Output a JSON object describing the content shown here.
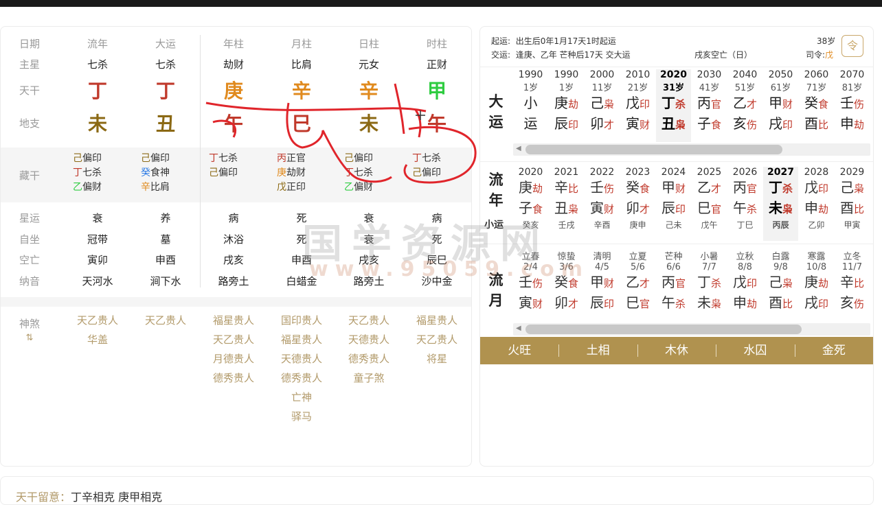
{
  "columns": [
    "日期",
    "流年",
    "大运",
    "年柱",
    "月柱",
    "日柱",
    "时柱"
  ],
  "zhuxing": [
    "主星",
    "七杀",
    "七杀",
    "劫财",
    "比肩",
    "元女",
    "正财"
  ],
  "tiangan": {
    "label": "天干",
    "chars": [
      "丁",
      "丁",
      "庚",
      "辛",
      "辛",
      "甲"
    ],
    "colors": [
      "#c0392b",
      "#c0392b",
      "#e08a1e",
      "#e08a1e",
      "#e08a1e",
      "#2ecc40"
    ]
  },
  "dizhi": {
    "label": "地支",
    "chars": [
      "未",
      "丑",
      "午",
      "巳",
      "未",
      "午"
    ],
    "colors": [
      "#8b6914",
      "#8b6914",
      "#c0392b",
      "#c0392b",
      "#8b6914",
      "#c0392b"
    ]
  },
  "canggan": {
    "label": "藏干",
    "cols": [
      [
        {
          "t": "己",
          "c": "#8b6914",
          "s": "偏印"
        },
        {
          "t": "丁",
          "c": "#c0392b",
          "s": "七杀"
        },
        {
          "t": "乙",
          "c": "#2ecc40",
          "s": "偏财"
        }
      ],
      [
        {
          "t": "己",
          "c": "#8b6914",
          "s": "偏印"
        },
        {
          "t": "癸",
          "c": "#2c7be5",
          "s": "食神"
        },
        {
          "t": "辛",
          "c": "#e08a1e",
          "s": "比肩"
        }
      ],
      [
        {
          "t": "丁",
          "c": "#c0392b",
          "s": "七杀"
        },
        {
          "t": "己",
          "c": "#8b6914",
          "s": "偏印"
        }
      ],
      [
        {
          "t": "丙",
          "c": "#c0392b",
          "s": "正官"
        },
        {
          "t": "庚",
          "c": "#e08a1e",
          "s": "劫财"
        },
        {
          "t": "戊",
          "c": "#8b6914",
          "s": "正印"
        }
      ],
      [
        {
          "t": "己",
          "c": "#8b6914",
          "s": "偏印"
        },
        {
          "t": "丁",
          "c": "#c0392b",
          "s": "七杀"
        },
        {
          "t": "乙",
          "c": "#2ecc40",
          "s": "偏财"
        }
      ],
      [
        {
          "t": "丁",
          "c": "#c0392b",
          "s": "七杀"
        },
        {
          "t": "己",
          "c": "#8b6914",
          "s": "偏印"
        }
      ]
    ]
  },
  "xingyun": [
    "星运",
    "衰",
    "养",
    "病",
    "死",
    "衰",
    "病"
  ],
  "zizuo": [
    "自坐",
    "冠带",
    "墓",
    "沐浴",
    "死",
    "衰",
    "死"
  ],
  "kongwang": [
    "空亡",
    "寅卯",
    "申酉",
    "戌亥",
    "申酉",
    "戌亥",
    "辰巳"
  ],
  "nayin": [
    "纳音",
    "天河水",
    "涧下水",
    "路旁土",
    "白蜡金",
    "路旁土",
    "沙中金"
  ],
  "shensha": {
    "label": "神煞",
    "cols": [
      [
        "天乙贵人",
        "华盖"
      ],
      [
        "天乙贵人"
      ],
      [
        "福星贵人",
        "天乙贵人",
        "月德贵人",
        "德秀贵人"
      ],
      [
        "国印贵人",
        "福星贵人",
        "天德贵人",
        "德秀贵人",
        "亡神",
        "驿马"
      ],
      [
        "天乙贵人",
        "天德贵人",
        "德秀贵人",
        "童子煞"
      ],
      [
        "福星贵人",
        "天乙贵人",
        "将星"
      ]
    ]
  },
  "header": {
    "qiyun_label": "起运:",
    "qiyun": "出生后0年1月17天1时起运",
    "jiaoyun_label": "交运:",
    "jiaoyun": "逢庚、乙年 芒种后17天 交大运",
    "age": "38岁",
    "kong": "戌亥空亡（日）",
    "siling_label": "司令:",
    "siling": "戊",
    "icon_char": "令"
  },
  "dayun": {
    "label_chars": [
      "大",
      "运"
    ],
    "cols": [
      {
        "y": "1990",
        "a": "1岁",
        "g1": "小",
        "s1": "",
        "g2": "运",
        "s2": ""
      },
      {
        "y": "1990",
        "a": "1岁",
        "g1": "庚",
        "s1": "劫",
        "g2": "辰",
        "s2": "印"
      },
      {
        "y": "2000",
        "a": "11岁",
        "g1": "己",
        "s1": "枭",
        "g2": "卯",
        "s2": "才"
      },
      {
        "y": "2010",
        "a": "21岁",
        "g1": "戊",
        "s1": "印",
        "g2": "寅",
        "s2": "财"
      },
      {
        "y": "2020",
        "a": "31岁",
        "g1": "丁",
        "s1": "杀",
        "g2": "丑",
        "s2": "枭",
        "hl": true
      },
      {
        "y": "2030",
        "a": "41岁",
        "g1": "丙",
        "s1": "官",
        "g2": "子",
        "s2": "食"
      },
      {
        "y": "2040",
        "a": "51岁",
        "g1": "乙",
        "s1": "才",
        "g2": "亥",
        "s2": "伤"
      },
      {
        "y": "2050",
        "a": "61岁",
        "g1": "甲",
        "s1": "财",
        "g2": "戌",
        "s2": "印"
      },
      {
        "y": "2060",
        "a": "71岁",
        "g1": "癸",
        "s1": "食",
        "g2": "酉",
        "s2": "比"
      },
      {
        "y": "2070",
        "a": "81岁",
        "g1": "壬",
        "s1": "伤",
        "g2": "申",
        "s2": "劫"
      }
    ]
  },
  "liunian": {
    "label_chars": [
      "流",
      "年"
    ],
    "sub_label": "小运",
    "cols": [
      {
        "y": "2020",
        "g1": "庚",
        "s1": "劫",
        "g2": "子",
        "s2": "食",
        "b": "癸亥"
      },
      {
        "y": "2021",
        "g1": "辛",
        "s1": "比",
        "g2": "丑",
        "s2": "枭",
        "b": "壬戌"
      },
      {
        "y": "2022",
        "g1": "壬",
        "s1": "伤",
        "g2": "寅",
        "s2": "财",
        "b": "辛酉"
      },
      {
        "y": "2023",
        "g1": "癸",
        "s1": "食",
        "g2": "卯",
        "s2": "才",
        "b": "庚申"
      },
      {
        "y": "2024",
        "g1": "甲",
        "s1": "财",
        "g2": "辰",
        "s2": "印",
        "b": "己未"
      },
      {
        "y": "2025",
        "g1": "乙",
        "s1": "才",
        "g2": "巳",
        "s2": "官",
        "b": "戊午"
      },
      {
        "y": "2026",
        "g1": "丙",
        "s1": "官",
        "g2": "午",
        "s2": "杀",
        "b": "丁巳"
      },
      {
        "y": "2027",
        "g1": "丁",
        "s1": "杀",
        "g2": "未",
        "s2": "枭",
        "b": "丙辰",
        "hl": true
      },
      {
        "y": "2028",
        "g1": "戊",
        "s1": "印",
        "g2": "申",
        "s2": "劫",
        "b": "乙卯"
      },
      {
        "y": "2029",
        "g1": "己",
        "s1": "枭",
        "g2": "酉",
        "s2": "比",
        "b": "甲寅"
      }
    ]
  },
  "liuyue": {
    "label_chars": [
      "流",
      "月"
    ],
    "cols": [
      {
        "jq": "立春",
        "d": "2/4",
        "g1": "壬",
        "s1": "伤",
        "g2": "寅",
        "s2": "财"
      },
      {
        "jq": "惊蛰",
        "d": "3/6",
        "g1": "癸",
        "s1": "食",
        "g2": "卯",
        "s2": "才"
      },
      {
        "jq": "清明",
        "d": "4/5",
        "g1": "甲",
        "s1": "财",
        "g2": "辰",
        "s2": "印"
      },
      {
        "jq": "立夏",
        "d": "5/6",
        "g1": "乙",
        "s1": "才",
        "g2": "巳",
        "s2": "官"
      },
      {
        "jq": "芒种",
        "d": "6/6",
        "g1": "丙",
        "s1": "官",
        "g2": "午",
        "s2": "杀"
      },
      {
        "jq": "小暑",
        "d": "7/7",
        "g1": "丁",
        "s1": "杀",
        "g2": "未",
        "s2": "枭"
      },
      {
        "jq": "立秋",
        "d": "8/8",
        "g1": "戊",
        "s1": "印",
        "g2": "申",
        "s2": "劫"
      },
      {
        "jq": "白露",
        "d": "9/8",
        "g1": "己",
        "s1": "枭",
        "g2": "酉",
        "s2": "比"
      },
      {
        "jq": "寒露",
        "d": "10/8",
        "g1": "庚",
        "s1": "劫",
        "g2": "戌",
        "s2": "印"
      },
      {
        "jq": "立冬",
        "d": "11/7",
        "g1": "辛",
        "s1": "比",
        "g2": "亥",
        "s2": "伤"
      }
    ]
  },
  "wuxing": [
    "火旺",
    "土相",
    "木休",
    "水囚",
    "金死"
  ],
  "bottom": {
    "label": "天干留意：",
    "text": "丁辛相克 庚甲相克"
  },
  "watermark": {
    "main": "国学资源网",
    "sub": "www.95059.com"
  }
}
